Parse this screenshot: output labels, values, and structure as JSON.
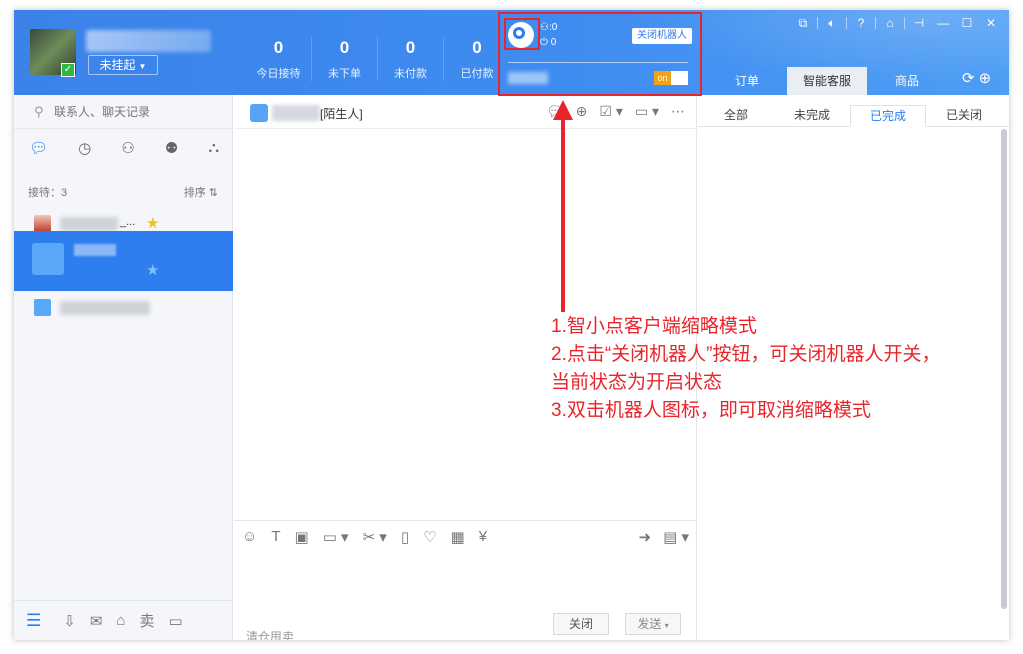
{
  "header": {
    "status_button": "未挂起",
    "stats": [
      {
        "value": "0",
        "label": "今日接待"
      },
      {
        "value": "0",
        "label": "未下单"
      },
      {
        "value": "0",
        "label": "未付款"
      },
      {
        "value": "0",
        "label": "已付款"
      }
    ],
    "robot": {
      "count_1": ":0",
      "count_2": "0",
      "close_button": "关闭机器人",
      "toggle_label": "on"
    },
    "tabs": [
      "订单",
      "智能客服",
      "商品"
    ]
  },
  "left": {
    "search_placeholder": "联系人、聊天记录",
    "reception_label": "接待：3",
    "sort_label": "排序",
    "contact_1_suffix": "_..."
  },
  "chat": {
    "contact_name": "[陌生人]",
    "hint": "清仓甩卖",
    "close_button": "关闭",
    "send_button": "发送"
  },
  "right": {
    "tabs": [
      "全部",
      "未完成",
      "已完成",
      "已关闭"
    ],
    "active_tab": "已完成"
  },
  "annotation": {
    "line1": "1.智小点客户端缩略模式",
    "line2": "2.点击“关闭机器人”按钮，可关闭机器人开关，",
    "line3": "当前状态为开启状态",
    "line4": "3.双击机器人图标，即可取消缩略模式"
  },
  "colors": {
    "header_blue": "#3b82e9",
    "accent": "#2c7cf0",
    "annotation_red": "#e8252b",
    "toggle_on": "#f3a216"
  }
}
